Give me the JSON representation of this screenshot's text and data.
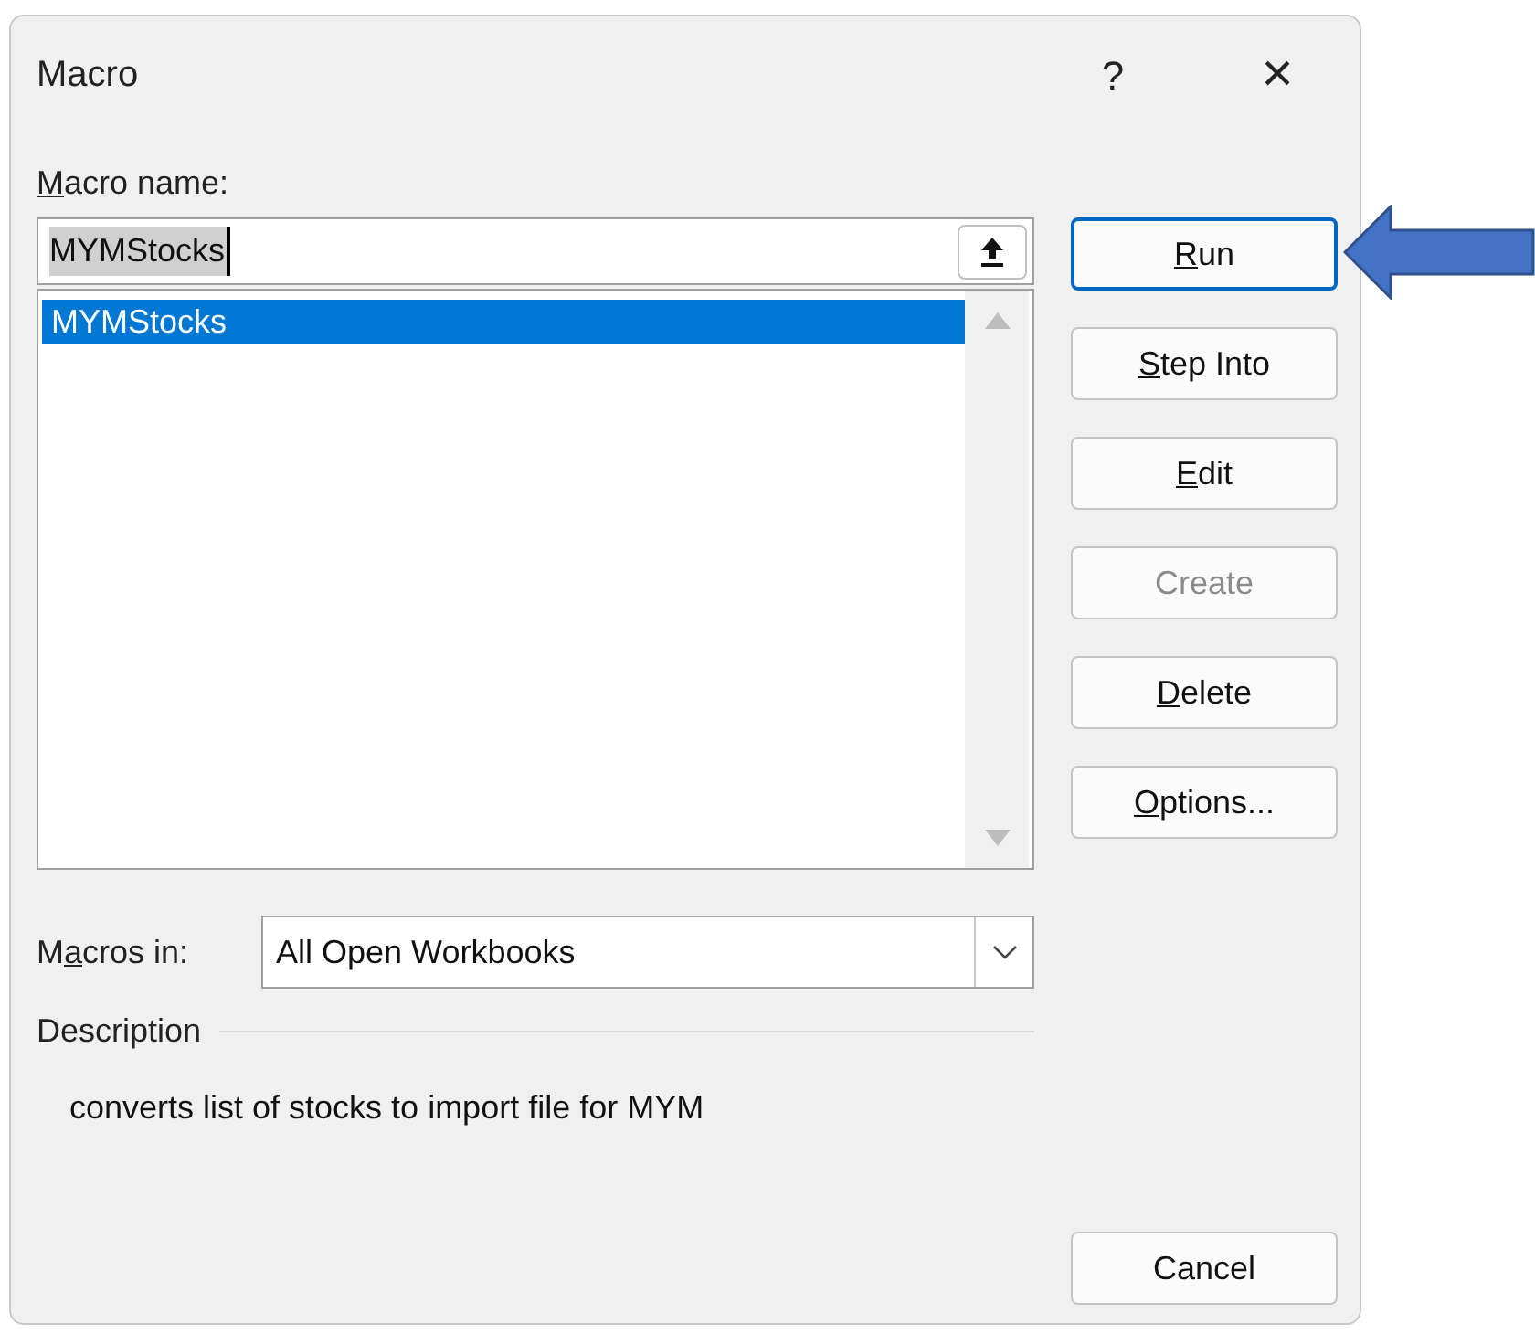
{
  "window": {
    "title": "Macro",
    "help": "?",
    "close": "×"
  },
  "macro_name": {
    "label": [
      {
        "text": "M",
        "underlined": true
      },
      {
        "text": "acro name:",
        "underlined": false
      }
    ],
    "value": "MYMStocks"
  },
  "macro_list": [
    {
      "name": "MYMStocks",
      "selected": true
    }
  ],
  "buttons": [
    {
      "label": [
        {
          "text": "R",
          "underlined": true
        },
        {
          "text": "un",
          "underlined": false
        }
      ],
      "default": true,
      "disabled": false
    },
    {
      "label": [
        {
          "text": "S",
          "underlined": true
        },
        {
          "text": "tep Into",
          "underlined": false
        }
      ],
      "default": false,
      "disabled": false
    },
    {
      "label": [
        {
          "text": "E",
          "underlined": true
        },
        {
          "text": "dit",
          "underlined": false
        }
      ],
      "default": false,
      "disabled": false
    },
    {
      "label": [
        {
          "text": "Create",
          "underlined": false
        }
      ],
      "default": false,
      "disabled": true
    },
    {
      "label": [
        {
          "text": "D",
          "underlined": true
        },
        {
          "text": "elete",
          "underlined": false
        }
      ],
      "default": false,
      "disabled": false
    },
    {
      "label": [
        {
          "text": "O",
          "underlined": true
        },
        {
          "text": "ptions...",
          "underlined": false
        }
      ],
      "default": false,
      "disabled": false
    }
  ],
  "macros_in": {
    "label": [
      {
        "text": "M",
        "underlined": false
      },
      {
        "text": "a",
        "underlined": true
      },
      {
        "text": "cros in:",
        "underlined": false
      }
    ],
    "value": "All Open Workbooks"
  },
  "description": {
    "heading": "Description",
    "text": "converts list of stocks to import file for MYM"
  },
  "cancel_button": {
    "label": "Cancel"
  }
}
